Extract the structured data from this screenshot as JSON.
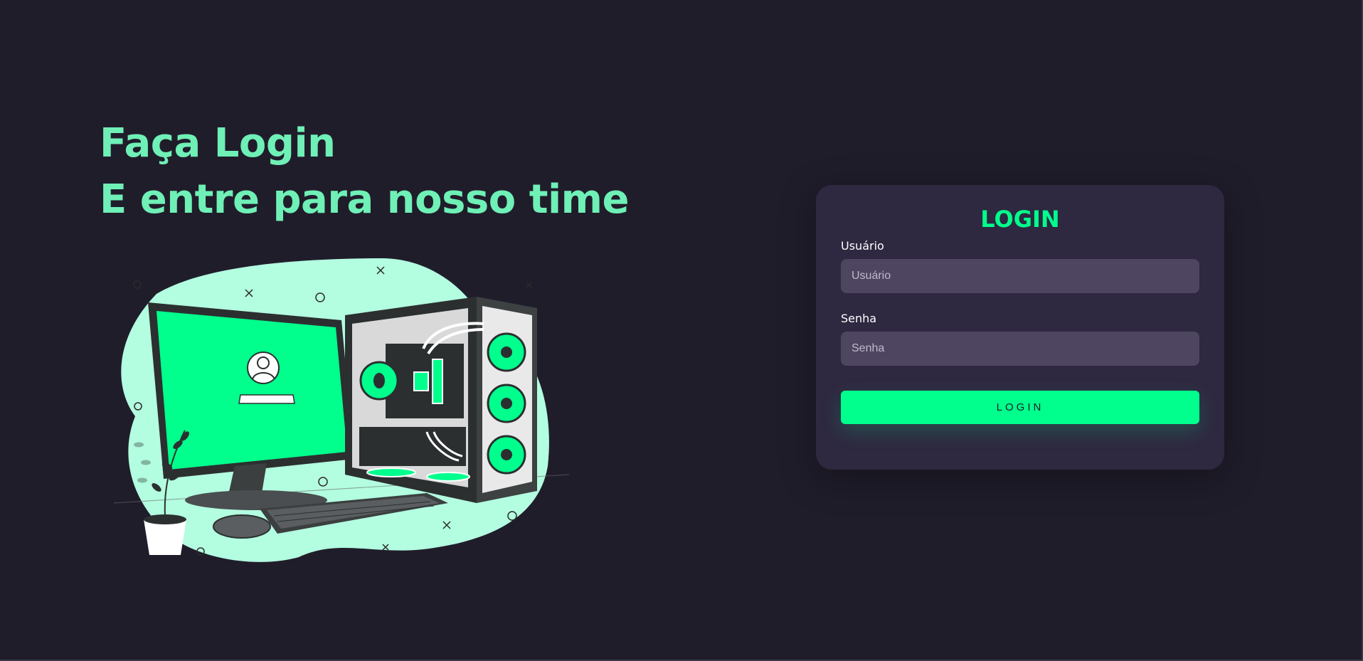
{
  "hero": {
    "line1": "Faça Login",
    "line2": "E entre para nosso time"
  },
  "login": {
    "title": "LOGIN",
    "username_label": "Usuário",
    "username_placeholder": "Usuário",
    "password_label": "Senha",
    "password_placeholder": "Senha",
    "button_label": "LOGIN"
  },
  "colors": {
    "background": "#201d2b",
    "accent": "#00ff8c",
    "headline": "#6ff0b6",
    "card": "#2e2840",
    "input": "#4e4661"
  },
  "illustration": {
    "icon": "computer-setup-illustration"
  }
}
